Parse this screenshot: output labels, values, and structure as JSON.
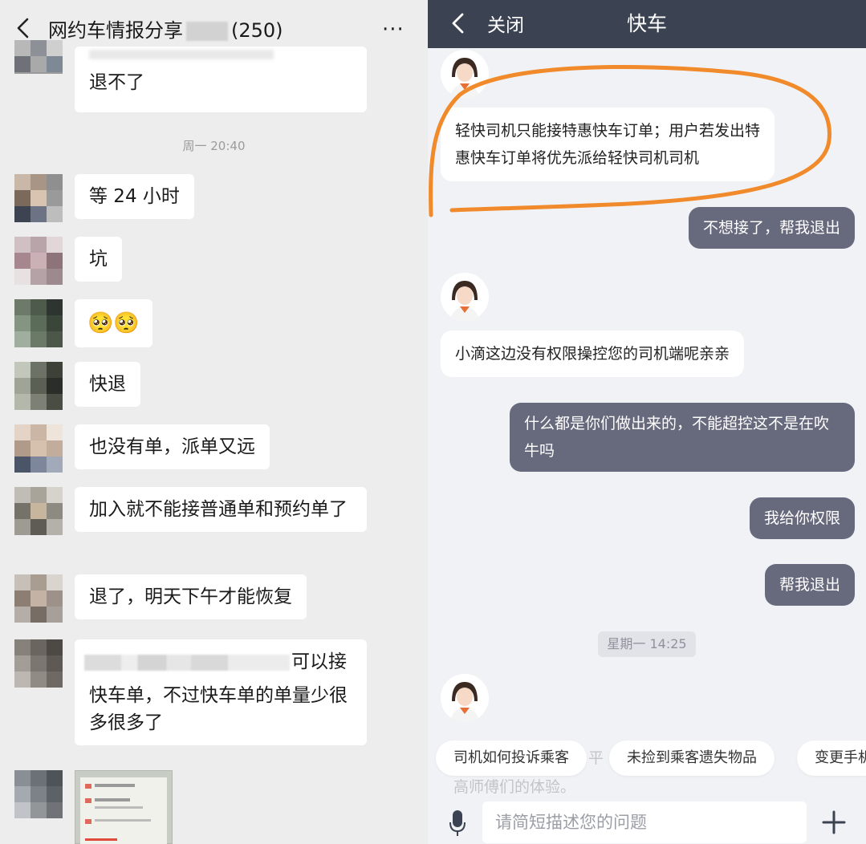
{
  "left": {
    "header": {
      "title_prefix": "网约车情报分享",
      "title_count": "(250)",
      "more_label": "···"
    },
    "messages": [
      {
        "text": "退不了"
      },
      {
        "text": "等 24 小时"
      },
      {
        "text": "坑"
      },
      {
        "text": "快退"
      },
      {
        "text": "也没有单，派单又远"
      },
      {
        "text": "加入就不能接普通单和预约单了"
      },
      {
        "text": "退了，明天下午才能恢复"
      },
      {
        "text_tail": "可以接",
        "text_more": "快车单，不过快车单的单量少很多很多了"
      }
    ],
    "time_label": "周一 20:40",
    "emoji": "🥺🥺"
  },
  "right": {
    "header": {
      "close_label": "关闭",
      "title": "快车"
    },
    "messages": {
      "agent_1": "轻快司机只能接特惠快车订单；用户若发出特惠快车订单将优先派给轻快司机司机",
      "user_1": "不想接了，帮我退出",
      "agent_2": "小滴这边没有权限操控您的司机端呢亲亲",
      "user_2": "什么都是你们做出来的，不能超控这不是在吹牛吗",
      "user_3": "我给你权限",
      "user_4": "帮我退出"
    },
    "time_label": "星期一 14:25",
    "quick_replies": [
      "司机如何投诉乘客",
      "未捡到乘客遗失物品",
      "变更手机"
    ],
    "faded_text_1": "高师傅们的体验。",
    "faded_text_2": "平",
    "input": {
      "placeholder": "请简短描述您的问题"
    }
  },
  "colors": {
    "left_bg": "#ededed",
    "right_header": "#3b4252",
    "user_bubble": "#676a7d",
    "annotation": "#f08a2a"
  }
}
